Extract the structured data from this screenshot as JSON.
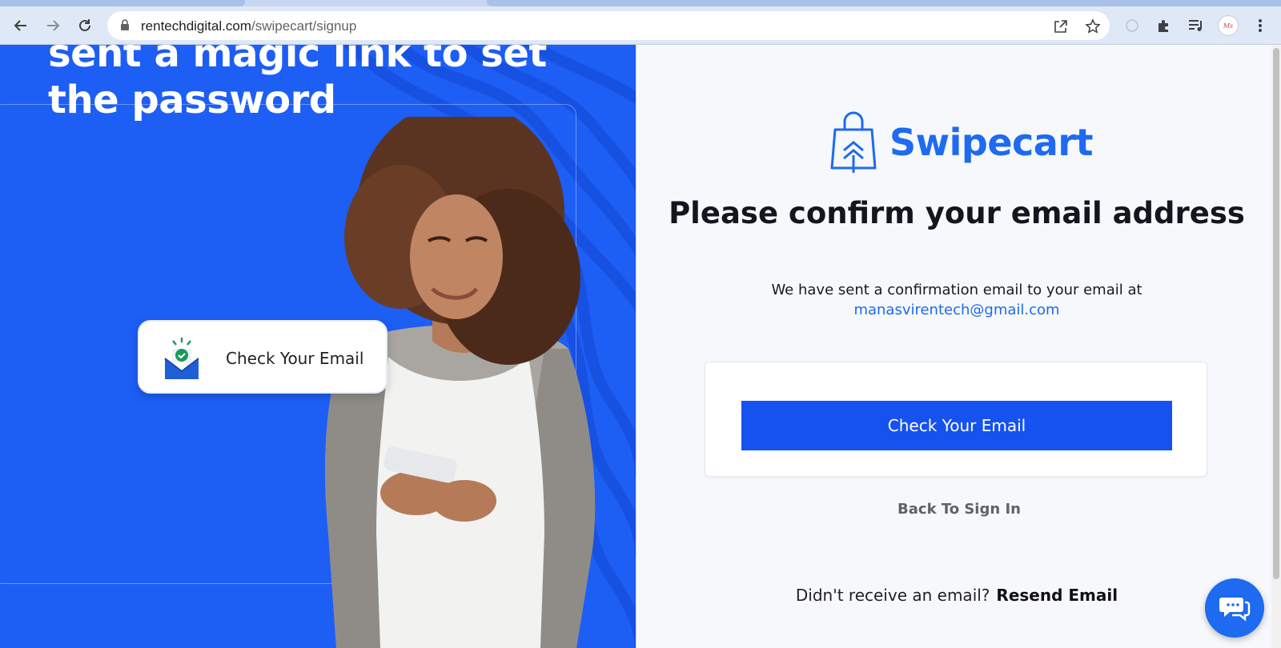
{
  "browser": {
    "url_domain": "rentechdigital.com",
    "url_path": "/swipecart/signup",
    "icons": [
      "back-icon",
      "forward-icon",
      "reload-icon",
      "lock-icon",
      "share-icon",
      "star-icon",
      "extension-icon",
      "puzzle-icon",
      "media-icon",
      "profile-avatar",
      "menu-icon"
    ]
  },
  "hero": {
    "title_line1": "sent a magic link to set",
    "title_line2": "the password",
    "card_label": "Check Your Email"
  },
  "panel": {
    "brand": "Swipecart",
    "heading": "Please confirm your email address",
    "subtext": "We have sent a confirmation email to your email at",
    "email": "manasvirentech@gmail.com",
    "cta_label": "Check Your Email",
    "back_label": "Back To Sign In",
    "resend_prompt": "Didn't receive an email?",
    "resend_label": "Resend Email"
  },
  "colors": {
    "brand_blue": "#1e6af0",
    "hero_blue": "#1d5ef5",
    "button_blue": "#1552f0"
  }
}
